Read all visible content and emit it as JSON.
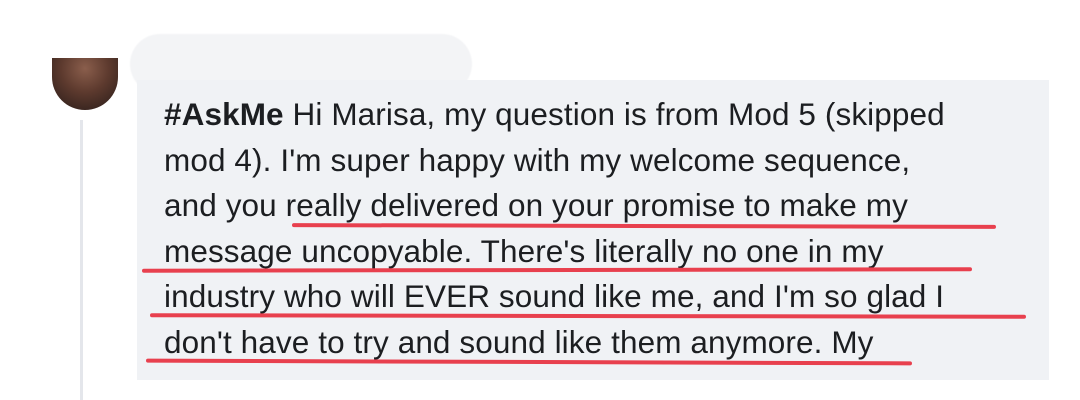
{
  "comment": {
    "hashtag": "#AskMe",
    "lines": [
      " Hi Marisa, my question is from Mod 5 (skipped",
      "mod 4). I'm super happy with my welcome sequence,",
      "and you really delivered on your promise to make my",
      "message uncopyable. There's literally no one in my",
      "industry who will EVER sound like me, and I'm so glad I",
      "don't have to try and sound like them anymore. My"
    ]
  },
  "colors": {
    "underline": "#e8404e",
    "bubble": "#f0f2f5",
    "text": "#1c1e21"
  },
  "icons": {
    "avatar": "user-avatar"
  }
}
